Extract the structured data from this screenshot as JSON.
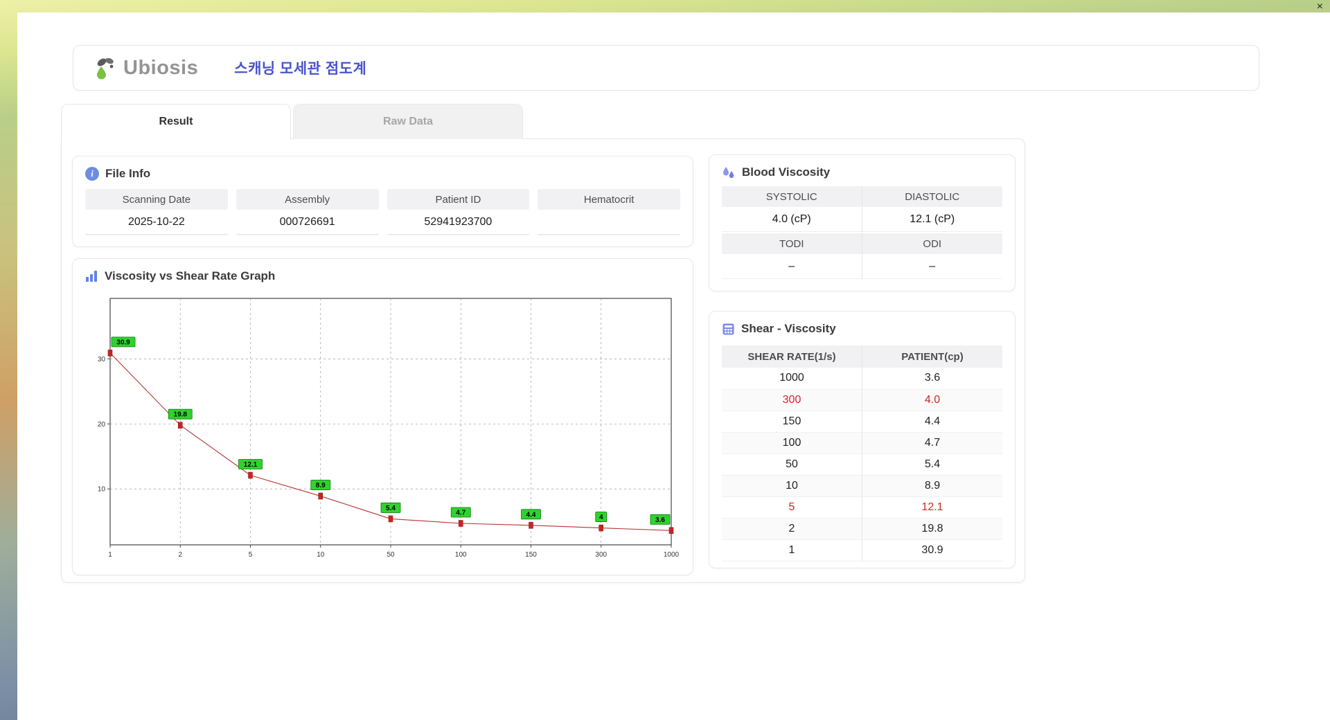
{
  "window": {
    "close_label": "×"
  },
  "header": {
    "logo_text": "Ubiosis",
    "title": "스캐닝 모세관 점도계"
  },
  "tabs": [
    {
      "label": "Result",
      "active": true
    },
    {
      "label": "Raw Data",
      "active": false
    }
  ],
  "file_info": {
    "title": "File Info",
    "fields": [
      {
        "label": "Scanning Date",
        "value": "2025-10-22"
      },
      {
        "label": "Assembly",
        "value": "000726691"
      },
      {
        "label": "Patient ID",
        "value": "52941923700"
      },
      {
        "label": "Hematocrit",
        "value": ""
      }
    ]
  },
  "graph": {
    "title": "Viscosity vs Shear Rate Graph"
  },
  "blood_viscosity": {
    "title": "Blood Viscosity",
    "cells": [
      {
        "label": "SYSTOLIC",
        "value": "4.0 (cP)"
      },
      {
        "label": "DIASTOLIC",
        "value": "12.1 (cP)"
      },
      {
        "label": "TODI",
        "value": "–"
      },
      {
        "label": "ODI",
        "value": "–"
      }
    ]
  },
  "shear_viscosity": {
    "title": "Shear - Viscosity",
    "columns": [
      "SHEAR RATE(1/s)",
      "PATIENT(cp)"
    ],
    "rows": [
      {
        "shear_rate": "1000",
        "patient": "3.6",
        "highlight": false
      },
      {
        "shear_rate": "300",
        "patient": "4.0",
        "highlight": true
      },
      {
        "shear_rate": "150",
        "patient": "4.4",
        "highlight": false
      },
      {
        "shear_rate": "100",
        "patient": "4.7",
        "highlight": false
      },
      {
        "shear_rate": "50",
        "patient": "5.4",
        "highlight": false
      },
      {
        "shear_rate": "10",
        "patient": "8.9",
        "highlight": false
      },
      {
        "shear_rate": "5",
        "patient": "12.1",
        "highlight": true
      },
      {
        "shear_rate": "2",
        "patient": "19.8",
        "highlight": false
      },
      {
        "shear_rate": "1",
        "patient": "30.9",
        "highlight": false
      }
    ]
  },
  "chart_data": {
    "type": "line",
    "title": "Viscosity vs Shear Rate Graph",
    "x": [
      1,
      2,
      5,
      10,
      50,
      100,
      150,
      300,
      1000
    ],
    "values": [
      30.9,
      19.8,
      12.1,
      8.9,
      5.4,
      4.7,
      4.4,
      4,
      3.6
    ],
    "point_labels": [
      "30.9",
      "19.8",
      "12.1",
      "8.9",
      "5.4",
      "4.7",
      "4.4",
      "4",
      "3.6"
    ],
    "xlabel": "",
    "ylabel": "",
    "x_scale": "categorical-even",
    "y_ticks": [
      10,
      20,
      30
    ],
    "ylim": [
      1.4,
      39.3
    ],
    "grid": "dashed",
    "legend": "none",
    "line_color": "#b83232",
    "marker_color": "#cc2222",
    "label_bg": "#2fd32f",
    "label_border": "#0c7a0c"
  },
  "colors": {
    "accent_blue": "#4853cc",
    "icon_blue": "#6d8de3",
    "highlight_red": "#d02525",
    "logo_green": "#7ac143"
  }
}
